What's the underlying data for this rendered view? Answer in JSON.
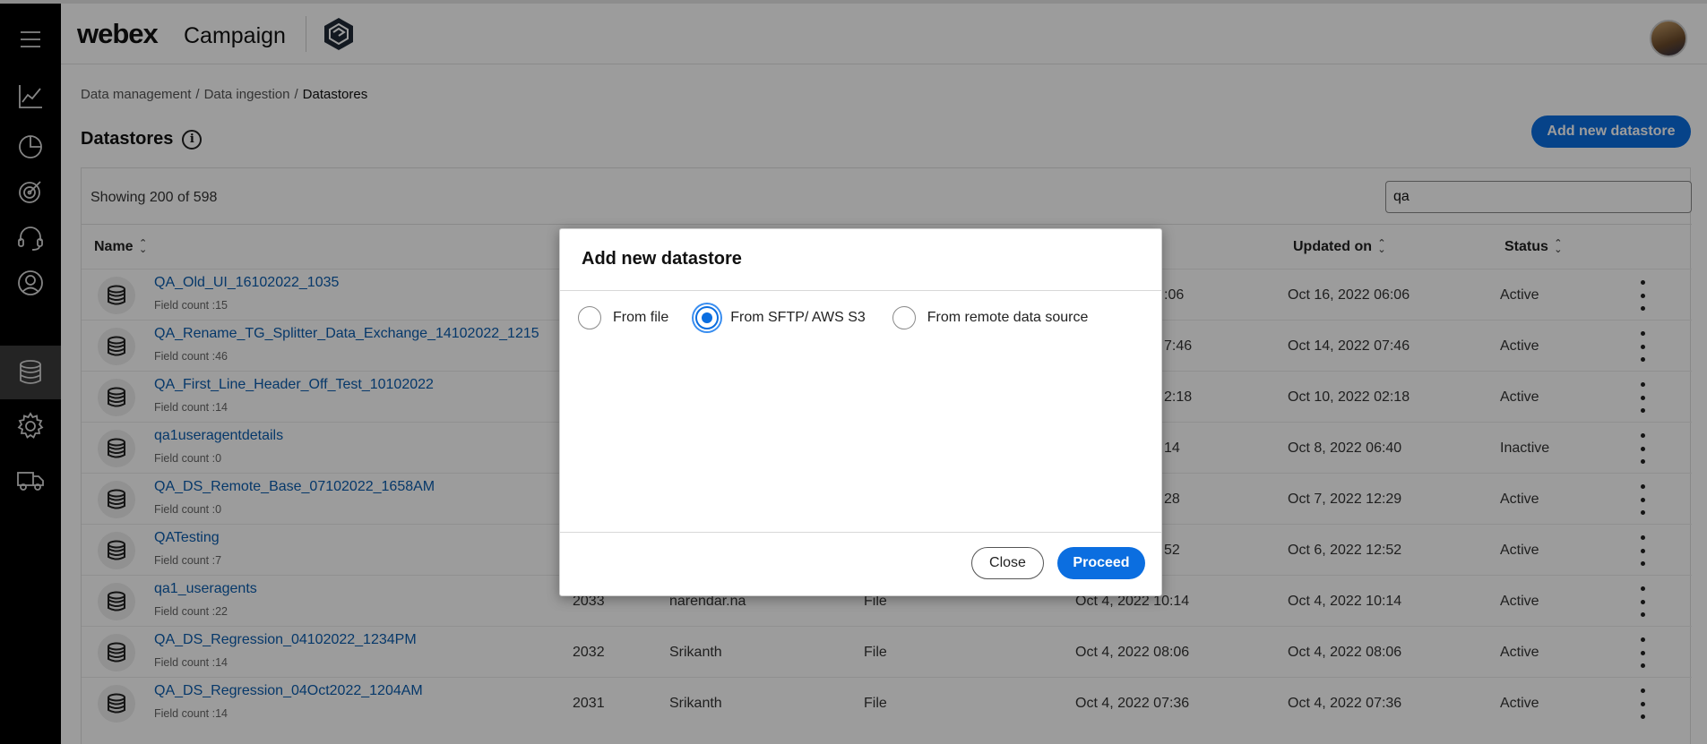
{
  "header": {
    "brand_primary": "webex",
    "brand_secondary": "Campaign"
  },
  "nav": {
    "icons": [
      "menu-icon",
      "analytics-icon",
      "pie-chart-icon",
      "target-icon",
      "headset-icon",
      "user-icon",
      "database-icon",
      "settings-icon",
      "truck-icon"
    ],
    "active": "database-icon"
  },
  "breadcrumb": {
    "items": [
      "Data management",
      "Data ingestion"
    ],
    "separator": "/",
    "current": "Datastores"
  },
  "page": {
    "title": "Datastores",
    "info_glyph": "i",
    "add_button": "Add new datastore"
  },
  "table": {
    "showing": "Showing 200 of 598",
    "search_value": "qa",
    "headers": {
      "name": "Name",
      "updated_on": "Updated on",
      "status": "Status"
    },
    "rows": [
      {
        "name": "QA_Old_UI_16102022_1035",
        "field_count": "Field count :15",
        "id": "",
        "created_by": "",
        "type": "",
        "created_on": "",
        "created_on_visible": ":06",
        "updated_on": "Oct 16, 2022 06:06",
        "status": "Active"
      },
      {
        "name": "QA_Rename_TG_Splitter_Data_Exchange_14102022_1215",
        "field_count": "Field count :46",
        "created_on_visible": "7:46",
        "updated_on": "Oct 14, 2022 07:46",
        "status": "Active"
      },
      {
        "name": "QA_First_Line_Header_Off_Test_10102022",
        "field_count": "Field count :14",
        "created_on_visible": "2:18",
        "updated_on": "Oct 10, 2022 02:18",
        "status": "Active"
      },
      {
        "name": "qa1useragentdetails",
        "field_count": "Field count :0",
        "created_on_visible": "14",
        "updated_on": "Oct 8, 2022 06:40",
        "status": "Inactive"
      },
      {
        "name": "QA_DS_Remote_Base_07102022_1658AM",
        "field_count": "Field count :0",
        "created_on_visible": "28",
        "updated_on": "Oct 7, 2022 12:29",
        "status": "Active"
      },
      {
        "name": "QATesting",
        "field_count": "Field count :7",
        "created_on_visible": "52",
        "updated_on": "Oct 6, 2022 12:52",
        "status": "Active"
      },
      {
        "name": "qa1_useragents",
        "field_count": "Field count :22",
        "id": "2033",
        "created_by": "narendar.na",
        "type": "File",
        "created_on_visible": "Oct 4, 2022 10:14",
        "updated_on": "Oct 4, 2022 10:14",
        "status": "Active"
      },
      {
        "name": "QA_DS_Regression_04102022_1234PM",
        "field_count": "Field count :14",
        "id": "2032",
        "created_by": "Srikanth",
        "type": "File",
        "created_on_visible": "Oct 4, 2022 08:06",
        "updated_on": "Oct 4, 2022 08:06",
        "status": "Active"
      },
      {
        "name": "QA_DS_Regression_04Oct2022_1204AM",
        "field_count": "Field count :14",
        "id": "2031",
        "created_by": "Srikanth",
        "type": "File",
        "created_on_visible": "Oct 4, 2022 07:36",
        "updated_on": "Oct 4, 2022 07:36",
        "status": "Active"
      }
    ]
  },
  "modal": {
    "title": "Add new datastore",
    "options": [
      {
        "label": "From file",
        "selected": false
      },
      {
        "label": "From SFTP/ AWS S3",
        "selected": true
      },
      {
        "label": "From remote data source",
        "selected": false
      }
    ],
    "close_label": "Close",
    "proceed_label": "Proceed"
  },
  "colors": {
    "accent": "#0b6ee0",
    "link": "#0b5cad",
    "rail": "#000000"
  }
}
